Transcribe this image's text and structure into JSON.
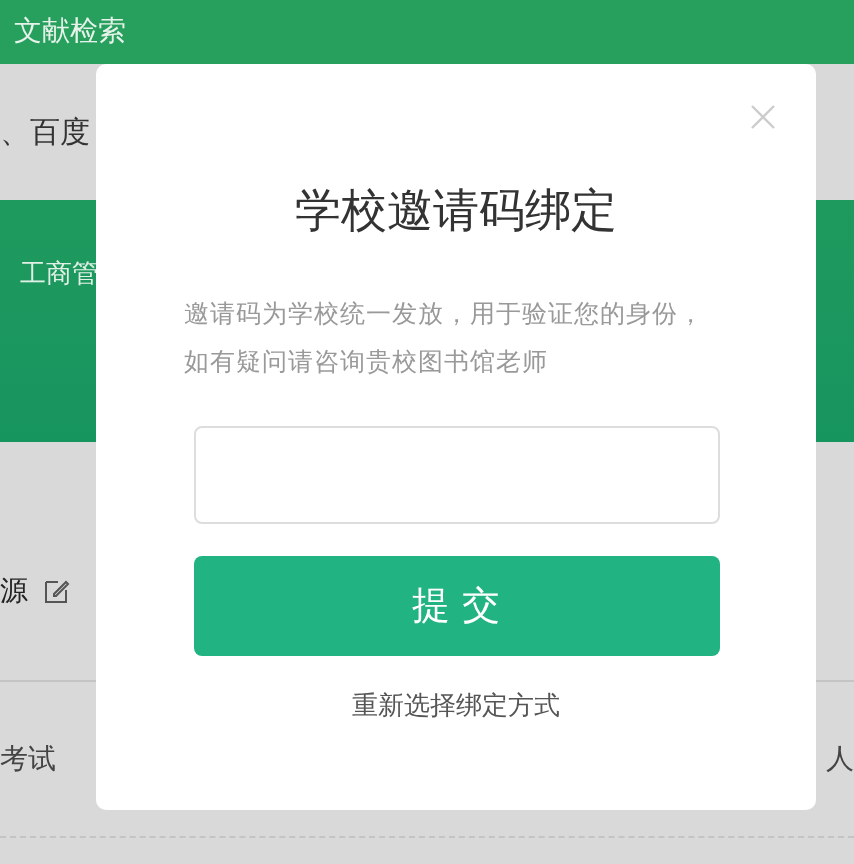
{
  "page": {
    "header_title": "文献检索",
    "search_hint": "、百度",
    "banner_text": "工商管",
    "source_label": "源",
    "list_left": "考试",
    "list_right": "人"
  },
  "dialog": {
    "title": "学校邀请码绑定",
    "description": "邀请码为学校统一发放，用于验证您的身份，如有疑问请咨询贵校图书馆老师",
    "submit": "提 交",
    "link": "重新选择绑定方式"
  }
}
